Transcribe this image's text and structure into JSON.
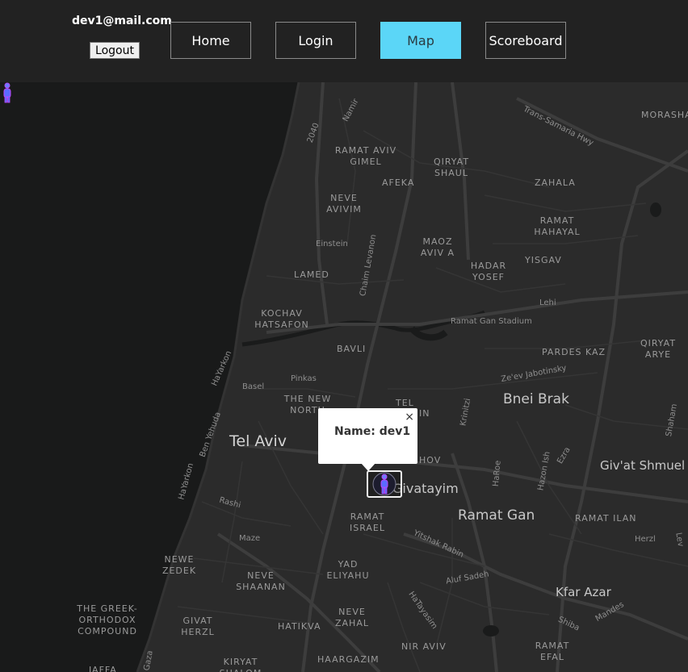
{
  "header": {
    "user_email": "dev1@mail.com",
    "logout_label": "Logout",
    "nav": {
      "home": "Home",
      "login": "Login",
      "map": "Map",
      "scoreboard": "Scoreboard"
    },
    "active_tab": "Map",
    "active_color": "#5bd6f7"
  },
  "map": {
    "popup": {
      "text": "Name: dev1",
      "close": "×"
    },
    "labels": {
      "ramat_aviv_gimel": "RAMAT AVIV GIMEL",
      "qiryat_shaul": "QIRYAT SHAUL",
      "afeka": "AFEKA",
      "zahala": "ZAHALA",
      "neve_avivim": "NEVE AVIVIM",
      "einstein": "Einstein",
      "chaim_levanon": "Chaim Levanon",
      "maoz_aviv_a": "MAOZ AVIV A",
      "hadar_yosef": "HADAR YOSEF",
      "yisgav": "YISGAV",
      "ramat_hahayal": "RAMAT HAHAYAL",
      "lamed": "LAMED",
      "kochav_hatsafon": "KOCHAV HATSAFON",
      "ramat_gan_stadium": "Ramat Gan Stadium",
      "lehi": "Lehi",
      "bavli": "BAVLI",
      "pardes_kaz": "PARDES KAZ",
      "qiryat_arye": "QIRYAT ARYE",
      "zeev_jabotinsky": "Ze'ev Jabotinsky",
      "hayarkon": "HaYarkon",
      "pinkas": "Pinkas",
      "basel": "Basel",
      "the_new_north": "THE NEW NORTH",
      "bnei_brak": "Bnei Brak",
      "tel": "TEL",
      "in": "IN",
      "krinitzi": "Krinitzi",
      "shaham": "Shaham",
      "ben_yehuda": "Ben Yehuda",
      "tel_aviv": "Tel Aviv",
      "hov": "HOV",
      "givat_shmuel": "Giv'at Shmuel",
      "ezra": "Ezra",
      "hazon_ish": "Hazon Ish",
      "haroe": "HaRoe",
      "hayarkon2": "HaYarkon",
      "rashi": "Rashi",
      "givatayim": "Givatayim",
      "ramat_gan": "Ramat Gan",
      "ramat_ilan": "RAMAT ILAN",
      "ramat_israel": "RAMAT ISRAEL",
      "maze": "Maze",
      "herzl": "Herzl",
      "lev": "Lev",
      "yitshak_rabin": "Yitshak Rabin",
      "newe_zedek": "NEWE ZEDEK",
      "neve_shaanan": "NEVE SHAANAN",
      "yad_eliyahu": "YAD ELIYAHU",
      "aluf_sadeh": "Aluf Sadeh",
      "kfar_azar": "Kfar Azar",
      "mandes": "Mandes",
      "the_greek_orthodox": "THE GREEK-ORTHODOX COMPOUND",
      "givat_herzl": "GIVAT HERZL",
      "hatikva": "HATIKVA",
      "neve_zahal": "NEVE ZAHAL",
      "hatayasim": "HaTayasim",
      "shiba": "Shiba",
      "nir_aviv": "NIR AVIV",
      "ramat_efal": "RAMAT EFAL",
      "gaza": "Gaza",
      "kiryat_shalom": "KIRYAT SHALOM",
      "haargazim": "HAARGAZIM",
      "jaffa": "JAFFA",
      "moras": "MORASHA",
      "trans_samaria": "Trans-Samaria Hwy",
      "namir": "Namir",
      "r2040": "2040"
    }
  }
}
